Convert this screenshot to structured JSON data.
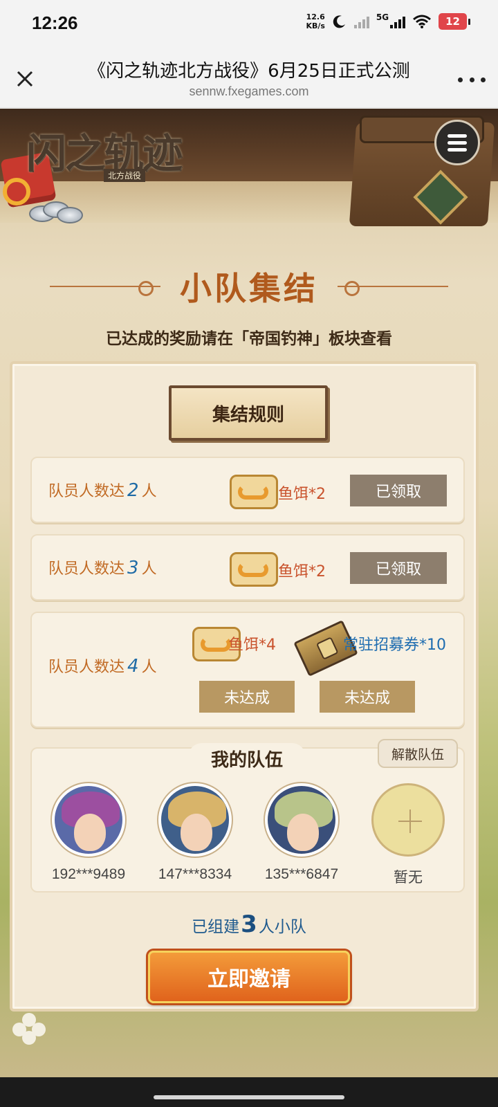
{
  "status_bar": {
    "time": "12:26",
    "net_speed_value": "12.6",
    "net_speed_unit": "KB/s",
    "network": "5G",
    "battery": "12"
  },
  "browser": {
    "title": "《闪之轨迹北方战役》6月25日正式公测",
    "url": "sennw.fxegames.com"
  },
  "game": {
    "logo_text": "闪之轨迹",
    "logo_sub": "北方战役",
    "section_title": "小队集结",
    "section_subtitle": "已达成的奖励请在「帝国钓神」板块查看",
    "rules_button": "集结规则",
    "rewards": [
      {
        "label_prefix": "队员人数达",
        "count": "2",
        "label_suffix": "人",
        "items": [
          {
            "icon": "bait-box-icon",
            "text": "鱼饵*2"
          }
        ],
        "buttons": [
          "已领取"
        ]
      },
      {
        "label_prefix": "队员人数达",
        "count": "3",
        "label_suffix": "人",
        "items": [
          {
            "icon": "bait-box-icon",
            "text": "鱼饵*2"
          }
        ],
        "buttons": [
          "已领取"
        ]
      },
      {
        "label_prefix": "队员人数达",
        "count": "4",
        "label_suffix": "人",
        "items": [
          {
            "icon": "bait-box-icon",
            "text": "鱼饵*4"
          },
          {
            "icon": "recruit-ticket-icon",
            "text": "常驻招募券*10"
          }
        ],
        "buttons": [
          "未达成",
          "未达成"
        ]
      }
    ],
    "team": {
      "title": "我的队伍",
      "disband_button": "解散队伍",
      "members": [
        {
          "id": "192***9489"
        },
        {
          "id": "147***8334"
        },
        {
          "id": "135***6847"
        },
        {
          "id": "暂无"
        }
      ],
      "status_prefix": "已组建",
      "status_count": "3",
      "status_suffix": "人小队"
    },
    "invite_button": "立即邀请"
  },
  "colors": {
    "accent_orange": "#e0631c",
    "title_brown": "#b05a1d",
    "claimed_gray": "#8d7e6d",
    "pending_tan": "#b89862",
    "count_blue": "#1f6ba6"
  }
}
